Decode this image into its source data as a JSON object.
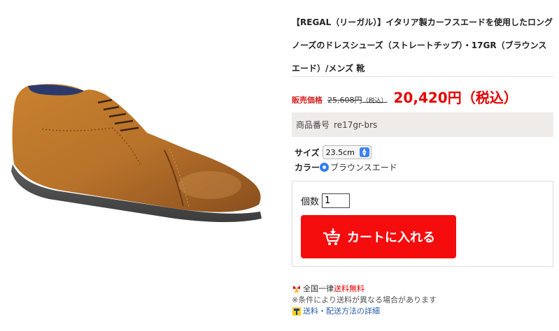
{
  "product": {
    "title": "【REGAL（リーガル）】イタリア製カーフスエードを使用したロングノーズのドレスシューズ（ストレートチップ）・17GR（ブラウンスエード）/メンズ 靴",
    "price_label": "販売価格",
    "old_price": "25,608円",
    "old_price_tax": "（税込）",
    "price": "20,420円（税込）",
    "sku_label": "商品番号",
    "sku": "re17gr-brs",
    "image_icon": "brown-suede-dress-shoe"
  },
  "options": {
    "size_label": "サイズ",
    "size_value": "23.5cm",
    "color_label": "カラー",
    "color_value": "ブラウンスエード"
  },
  "cart": {
    "qty_label": "個数",
    "qty_value": "1",
    "button_label": "カートに入れる",
    "button_icon": "cart-icon",
    "button_color": "#f50c0c"
  },
  "shipping": {
    "line1_prefix": "全国一律",
    "line1_highlight": "送料無料",
    "line2": "※条件により送料が異なる場合があります",
    "line3_link": "送料・配送方法の詳細",
    "icons": [
      "gift-ribbon-icon",
      "delivery-truck-icon"
    ]
  },
  "colors": {
    "accent_red": "#e60000",
    "sku_bg": "#efebe9"
  }
}
